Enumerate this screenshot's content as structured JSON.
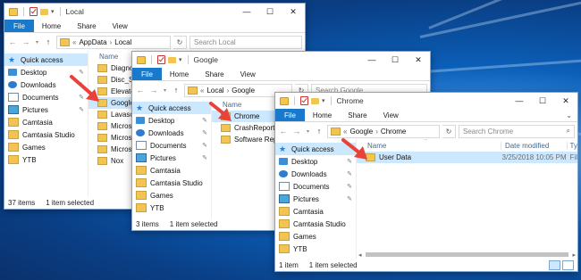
{
  "win1": {
    "title": "Local",
    "ribbon": [
      "File",
      "Home",
      "Share",
      "View"
    ],
    "address": [
      "AppData",
      "Local"
    ],
    "search_placeholder": "Search Local",
    "col_name": "Name",
    "nav": [
      {
        "label": "Quick access",
        "icon": "star-icon"
      },
      {
        "label": "Desktop",
        "icon": "desktop-icon",
        "pin": true
      },
      {
        "label": "Downloads",
        "icon": "downloads-icon",
        "pin": true
      },
      {
        "label": "Documents",
        "icon": "documents-icon",
        "pin": true
      },
      {
        "label": "Pictures",
        "icon": "pictures-icon",
        "pin": true
      },
      {
        "label": "Camtasia",
        "icon": "folder-icon"
      },
      {
        "label": "Camtasia Studio",
        "icon": "folder-icon"
      },
      {
        "label": "Games",
        "icon": "folder-icon"
      },
      {
        "label": "YTB",
        "icon": "folder-icon"
      }
    ],
    "files": [
      "Diagnostic",
      "Disc_Soft",
      "ElevatedD",
      "Google",
      "Lavasoft",
      "Microsoft",
      "Microsoft",
      "Microsoft",
      "Nox"
    ],
    "selected_file": "Google",
    "status_count": "37 items",
    "status_selected": "1 item selected"
  },
  "win2": {
    "title": "Google",
    "ribbon": [
      "File",
      "Home",
      "Share",
      "View"
    ],
    "address": [
      "Local",
      "Google"
    ],
    "search_placeholder": "Search Google",
    "col_name": "Name",
    "nav": [
      {
        "label": "Quick access",
        "icon": "star-icon"
      },
      {
        "label": "Desktop",
        "icon": "desktop-icon",
        "pin": true
      },
      {
        "label": "Downloads",
        "icon": "downloads-icon",
        "pin": true
      },
      {
        "label": "Documents",
        "icon": "documents-icon",
        "pin": true
      },
      {
        "label": "Pictures",
        "icon": "pictures-icon",
        "pin": true
      },
      {
        "label": "Camtasia",
        "icon": "folder-icon"
      },
      {
        "label": "Camtasia Studio",
        "icon": "folder-icon"
      },
      {
        "label": "Games",
        "icon": "folder-icon"
      },
      {
        "label": "YTB",
        "icon": "folder-icon"
      }
    ],
    "files": [
      "Chrome",
      "CrashReports",
      "Software Repo"
    ],
    "selected_file": "Chrome",
    "status_count": "3 items",
    "status_selected": "1 item selected"
  },
  "win3": {
    "title": "Chrome",
    "ribbon": [
      "File",
      "Home",
      "Share",
      "View"
    ],
    "address": [
      "Google",
      "Chrome"
    ],
    "search_placeholder": "Search Chrome",
    "cols": [
      "Name",
      "Date modified",
      "Ty"
    ],
    "nav": [
      {
        "label": "Quick access",
        "icon": "star-icon"
      },
      {
        "label": "Desktop",
        "icon": "desktop-icon",
        "pin": true
      },
      {
        "label": "Downloads",
        "icon": "downloads-icon",
        "pin": true
      },
      {
        "label": "Documents",
        "icon": "documents-icon",
        "pin": true
      },
      {
        "label": "Pictures",
        "icon": "pictures-icon",
        "pin": true
      },
      {
        "label": "Camtasia",
        "icon": "folder-icon"
      },
      {
        "label": "Camtasia Studio",
        "icon": "folder-icon"
      },
      {
        "label": "Games",
        "icon": "folder-icon"
      },
      {
        "label": "YTB",
        "icon": "folder-icon"
      }
    ],
    "files": [
      {
        "name": "User Data",
        "date": "3/25/2018 10:05 PM",
        "type": "Fil"
      }
    ],
    "status_count": "1 item",
    "status_selected": "1 item selected"
  },
  "colors": {
    "file_tab": "#1979ca",
    "selection": "#cce8ff",
    "arrow": "#e8423a",
    "folder": "#f2c553"
  }
}
